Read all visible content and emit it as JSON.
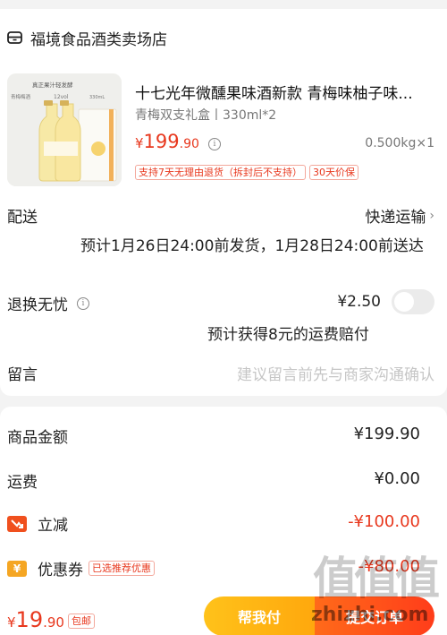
{
  "store": {
    "name": "福境食品酒类卖场店",
    "icon": "store-icon"
  },
  "product": {
    "title": "十七光年微醺果味酒新款 青梅味柚子味...",
    "spec": "青梅双支礼盒丨330ml*2",
    "price_symbol": "¥",
    "price_int": "199",
    "price_dec": ".90",
    "weight": "0.500kg×1",
    "tags": [
      "支持7天无理由退货（拆封后不支持）",
      "30天价保"
    ],
    "image_texts": {
      "headline": "真正果汁轻发酵",
      "left": "青梅梅酒",
      "mid": "12vol",
      "right": "330mL"
    }
  },
  "delivery": {
    "label": "配送",
    "method": "快递运输",
    "estimate": "预计1月26日24:00前发货，1月28日24:00前送达"
  },
  "return_insurance": {
    "label": "退换无忧",
    "price": "¥2.50",
    "note": "预计获得8元的运费赔付",
    "enabled": false
  },
  "message": {
    "label": "留言",
    "placeholder": "建议留言前先与商家沟通确认"
  },
  "fees": {
    "goods_label": "商品金额",
    "goods_value": "¥199.90",
    "shipping_label": "运费",
    "shipping_value": "¥0.00",
    "discount_label": "立减",
    "discount_value": "-¥100.00",
    "coupon_label": "优惠券",
    "coupon_tag": "已选推荐优惠",
    "coupon_value": "-¥80.00"
  },
  "bottom": {
    "total_symbol": "¥",
    "total_int": "19",
    "total_dec": ".90",
    "shipping_badge": "包邮",
    "help_pay_label": "帮我付",
    "pay_label": "提交订单"
  },
  "watermark": {
    "glyphs": "值值值",
    "text": "zhizhi.com"
  },
  "colors": {
    "accent": "#e8381e",
    "help_btn": "#ffb31a",
    "pay_btn": "#ff4d1a"
  }
}
